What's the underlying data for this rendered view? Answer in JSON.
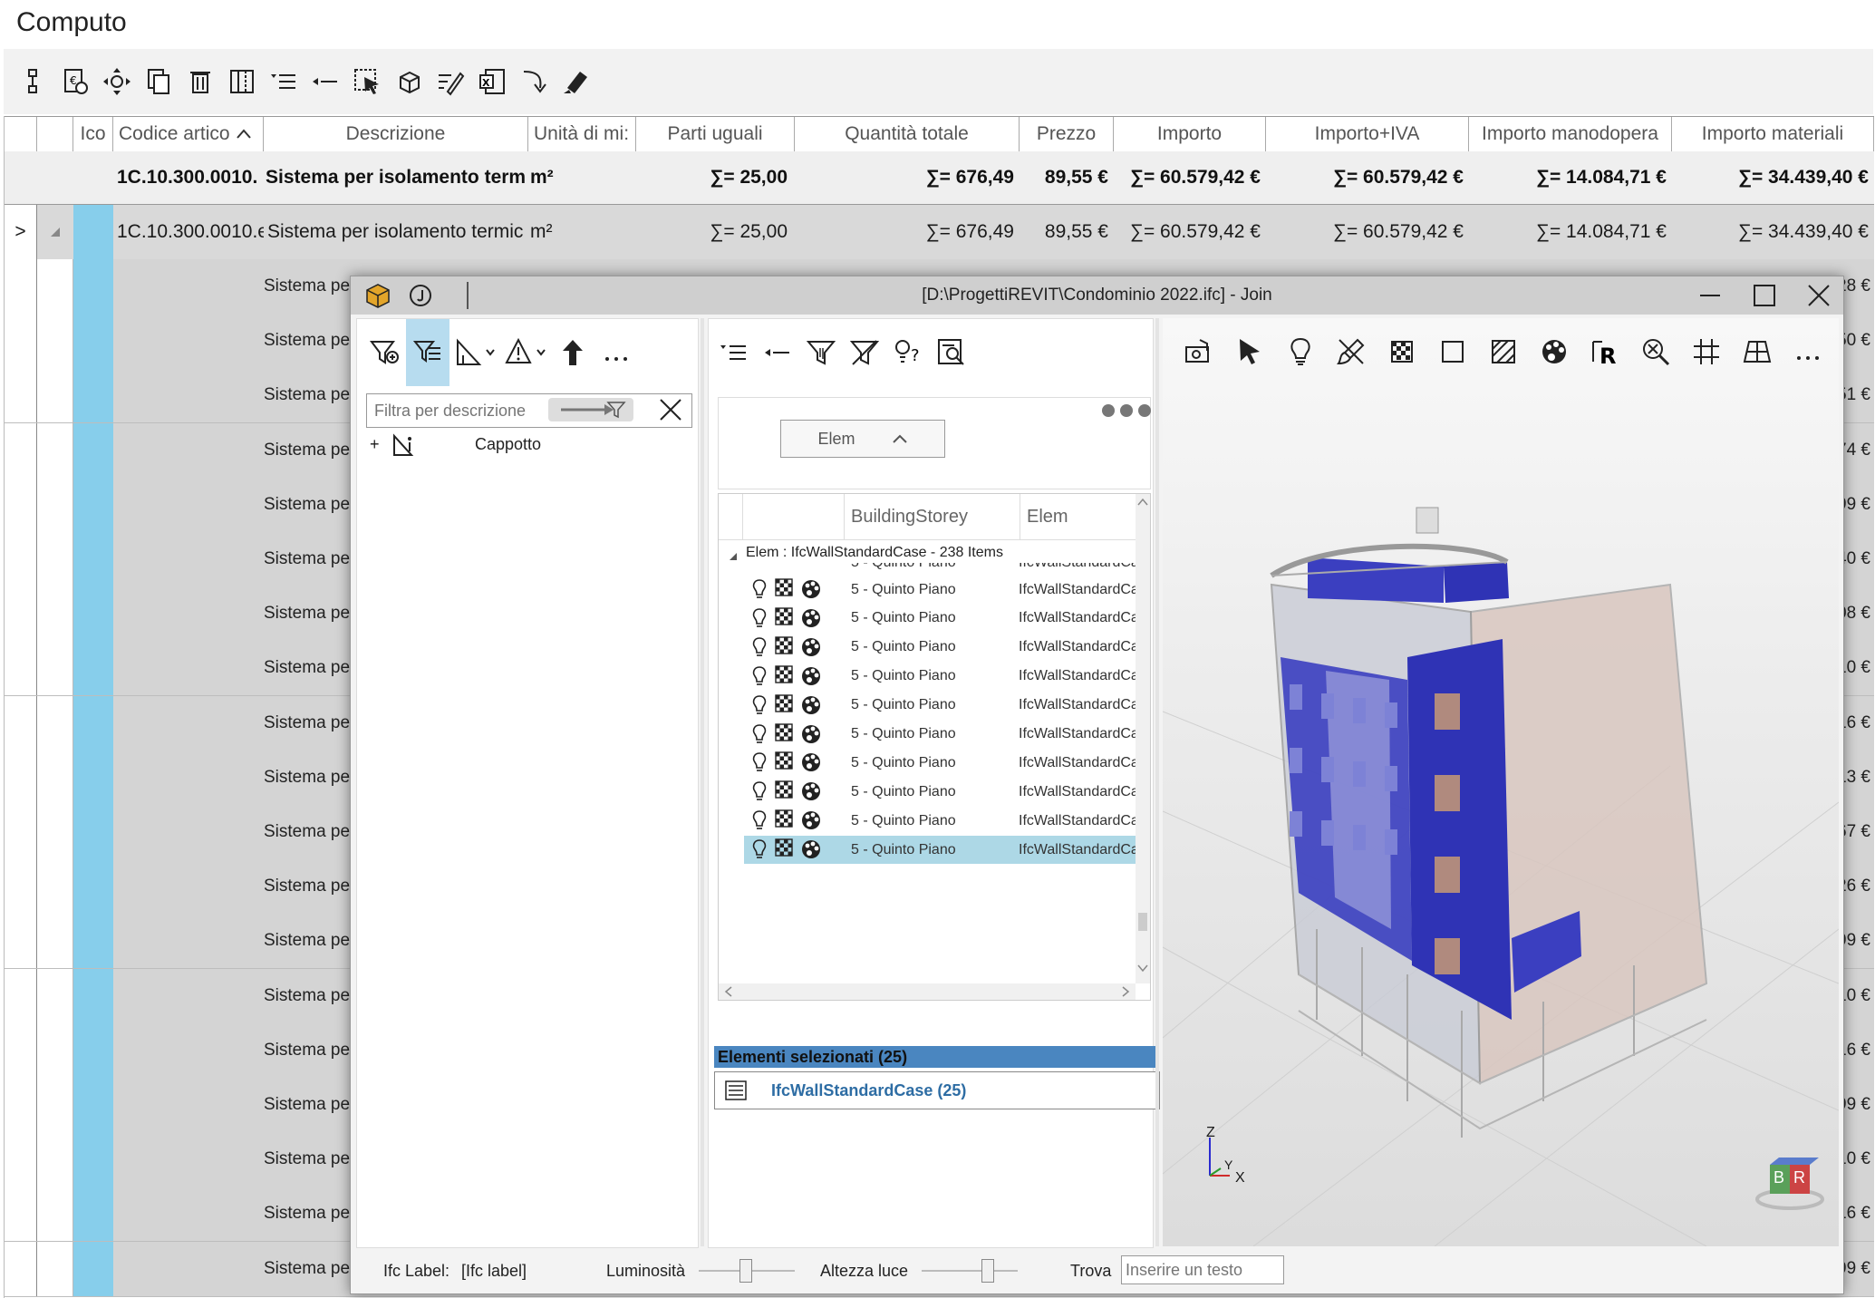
{
  "app_title": "Computo",
  "toolbar": {
    "icons": [
      "tree-structure-icon",
      "add-price-icon",
      "move-icon",
      "copy-icon",
      "delete-icon",
      "columns-icon",
      "expand-list-icon",
      "collapse-list-icon",
      "select-cursor-icon",
      "3d-box-icon",
      "edit-pen-icon",
      "excel-export-icon",
      "import-arrow-icon",
      "highlighter-icon"
    ]
  },
  "grid": {
    "columns": [
      "Ico",
      "Codice artico",
      "Descrizione",
      "Unità di mi:",
      "Parti uguali",
      "Quantità totale",
      "Prezzo",
      "Importo",
      "Importo+IVA",
      "Importo manodopera",
      "Importo materiali"
    ],
    "summary_row": {
      "code": "1C.10.300.0010.",
      "description": "Sistema per isolamento term",
      "unit": "m²",
      "parti": "∑= 25,00",
      "quantita": "∑= 676,49",
      "prezzo": "89,55 €",
      "importo": "∑= 60.579,42 €",
      "importo_iva": "∑= 60.579,42 €",
      "manodopera": "∑= 14.084,71 €",
      "materiali": "∑= 34.439,40 €"
    },
    "group_row": {
      "expander": ">",
      "code": "1C.10.300.0010.e",
      "description": "Sistema per isolamento termic",
      "unit": "m²",
      "parti": "∑= 25,00",
      "quantita": "∑= 676,49",
      "prezzo": "89,55 €",
      "importo": "∑= 60.579,42 €",
      "importo_iva": "∑= 60.579,42 €",
      "manodopera": "∑= 14.084,71 €",
      "materiali": "∑= 34.439,40 €"
    },
    "rows": [
      {
        "desc": "Sistema per",
        "val": "28 €"
      },
      {
        "desc": "Sistema per",
        "val": "50 €"
      },
      {
        "desc": "Sistema per",
        "val": "51 €"
      },
      {
        "desc": "Sistema per",
        "val": "74 €"
      },
      {
        "desc": "Sistema per",
        "val": "99 €"
      },
      {
        "desc": "Sistema per",
        "val": "40 €"
      },
      {
        "desc": "Sistema per",
        "val": "08 €"
      },
      {
        "desc": "Sistema per",
        "val": "10 €"
      },
      {
        "desc": "Sistema per",
        "val": "16 €"
      },
      {
        "desc": "Sistema per",
        "val": "13 €"
      },
      {
        "desc": "Sistema per",
        "val": "67 €"
      },
      {
        "desc": "Sistema per",
        "val": "26 €"
      },
      {
        "desc": "Sistema per",
        "val": "99 €"
      },
      {
        "desc": "Sistema per",
        "val": "10 €"
      },
      {
        "desc": "Sistema per",
        "val": "16 €"
      },
      {
        "desc": "Sistema per",
        "val": "99 €"
      },
      {
        "desc": "Sistema per",
        "val": "10 €"
      },
      {
        "desc": "Sistema per",
        "val": "16 €"
      },
      {
        "desc": "Sistema per",
        "val": "99 €"
      }
    ]
  },
  "join": {
    "title": "[D:\\ProgettiREVIT\\Condominio 2022.ifc] - Join",
    "filter_placeholder": "Filtra per descrizione",
    "tree_item": "Cappotto",
    "group_chip": "Elem",
    "col_storey": "BuildingStorey",
    "col_elem": "Elem",
    "group_header": "Elem : IfcWallStandardCase - 238 Items",
    "partial_row": {
      "storey": "5 - Quinto Piano",
      "elem": "IfcWallStandardCase"
    },
    "rows": [
      {
        "storey": "5 - Quinto Piano",
        "elem": "IfcWallStandardCa"
      },
      {
        "storey": "5 - Quinto Piano",
        "elem": "IfcWallStandardCa"
      },
      {
        "storey": "5 - Quinto Piano",
        "elem": "IfcWallStandardCa"
      },
      {
        "storey": "5 - Quinto Piano",
        "elem": "IfcWallStandardCa"
      },
      {
        "storey": "5 - Quinto Piano",
        "elem": "IfcWallStandardCa"
      },
      {
        "storey": "5 - Quinto Piano",
        "elem": "IfcWallStandardCa"
      },
      {
        "storey": "5 - Quinto Piano",
        "elem": "IfcWallStandardCa"
      },
      {
        "storey": "5 - Quinto Piano",
        "elem": "IfcWallStandardCa"
      },
      {
        "storey": "5 - Quinto Piano",
        "elem": "IfcWallStandardCa"
      },
      {
        "storey": "5 - Quinto Piano",
        "elem": "IfcWallStandardCa"
      }
    ],
    "selected_title": "Elementi selezionati (25)",
    "selected_item": "IfcWallStandardCase (25)",
    "status": {
      "ifc_label_caption": "Ifc Label:",
      "ifc_label_value": "[Ifc label]",
      "brightness_label": "Luminosità",
      "brightness_level": 0.48,
      "light_height_label": "Altezza luce",
      "light_height_level": 0.7,
      "search_label": "Trova",
      "search_placeholder": "Inserire un testo"
    },
    "axis": {
      "z": "Z",
      "y": "Y",
      "x": "X"
    },
    "cube": {
      "b": "B",
      "r": "R"
    },
    "accent_color": "#3b3fc0",
    "selection_color": "#add8e6"
  }
}
